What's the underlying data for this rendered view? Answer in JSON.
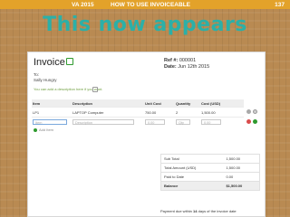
{
  "slide": {
    "header_left": "VA 2015",
    "header_center": "HOW TO USE INVOICEABLE",
    "page_number": "137",
    "title": "This now appears"
  },
  "invoice": {
    "title": "Invoice",
    "ref_label": "Ref #:",
    "ref_value": "000001",
    "date_label": "Date:",
    "date_value": "Jun 12th 2015",
    "to_label": "To:",
    "to_name": "Sally Hungry",
    "description_prompt": "You can add a description here if you want."
  },
  "items_table": {
    "headers": [
      "Item",
      "Description",
      "Unit Cost",
      "Quantity",
      "Cost (USD)"
    ],
    "rows": [
      {
        "item": "LP1",
        "description": "LAPTOP Computer",
        "unit_cost": "750.00",
        "quantity": "2",
        "cost": "1,500.00"
      }
    ],
    "new_row": {
      "item_placeholder": "Item",
      "description_placeholder": "Description",
      "unit_cost": "0.00",
      "quantity": "Qty",
      "cost": "0.00"
    },
    "add_label": "Add Item"
  },
  "totals": [
    {
      "label": "Sub Total",
      "value": "1,500.00"
    },
    {
      "label": "Total Amount (USD)",
      "value": "1,500.00"
    },
    {
      "label": "Paid to Date",
      "value": "0.00"
    },
    {
      "label": "Balance",
      "value": "$1,500.00"
    }
  ],
  "payment_note": {
    "prefix": "Payment due within",
    "days": "14",
    "suffix": "days of the invoice date"
  },
  "colors": {
    "header_bar": "#e3a22a",
    "title": "#2bb0a8",
    "background": "#b98a52"
  }
}
